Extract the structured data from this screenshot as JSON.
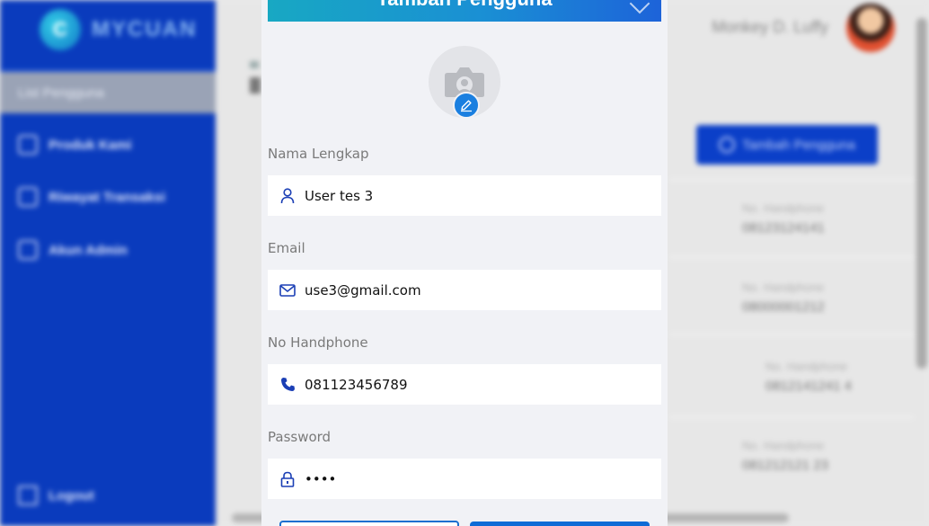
{
  "background": {
    "brand_name": "MYCUAN",
    "brand_initial": "C",
    "sidebar": {
      "active_item": "List Pengguna",
      "items": [
        {
          "label": "Produk Kami",
          "icon": "product-icon"
        },
        {
          "label": "Riwayat Transaksi",
          "icon": "history-icon"
        },
        {
          "label": "Akun Admin",
          "icon": "admin-icon"
        }
      ],
      "logout_label": "Logout"
    },
    "user_name": "Monkey D. Luffy",
    "add_user_label": "Tambah Pengguna",
    "table": {
      "phone_header": "No. Handphone",
      "rows": [
        "08123124141",
        "08000001212",
        "0812141241 4",
        "081212121 23"
      ]
    }
  },
  "modal": {
    "header_title": "Tambah Pengguna",
    "fields": [
      {
        "label": "Nama Lengkap",
        "value": "User tes 3",
        "icon": "user-icon"
      },
      {
        "label": "Email",
        "value": "use3@gmail.com",
        "icon": "mail-icon"
      },
      {
        "label": "No Handphone",
        "value": "081123456789",
        "icon": "phone-icon"
      },
      {
        "label": "Password",
        "value": "••••",
        "icon": "lock-icon"
      }
    ]
  },
  "colors": {
    "sidebar": "#0a3bbd",
    "accent": "#1a7fe0",
    "icon": "#1b3fb5"
  }
}
